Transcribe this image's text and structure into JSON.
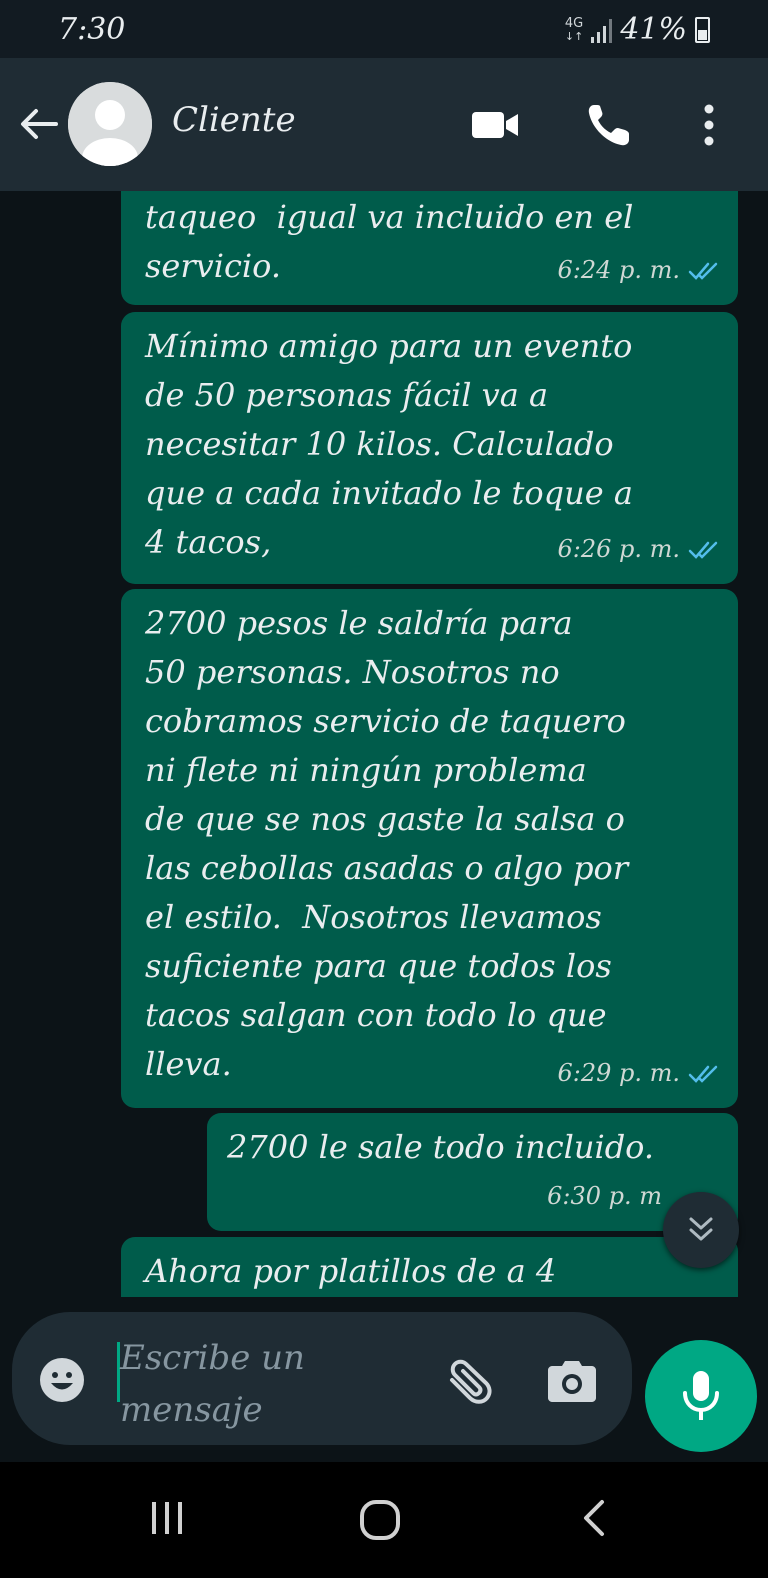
{
  "status": {
    "time": "7:30",
    "network": "4G",
    "battery": "41%"
  },
  "header": {
    "contact_name": "Cliente"
  },
  "messages": [
    {
      "text": "taqueo  igual va incluido en el\nservicio.",
      "time": "6:24 p. m."
    },
    {
      "text": "Mínimo amigo para un evento\nde 50 personas fácil va a\nnecesitar 10 kilos. Calculado\nque a cada invitado le toque a\n4 tacos,",
      "time": "6:26 p. m."
    },
    {
      "text": "2700 pesos le saldría para\n50 personas. Nosotros no\ncobramos servicio de taquero\nni flete ni ningún problema\nde que se nos gaste la salsa o\nlas cebollas asadas o algo por\nel estilo.  Nosotros llevamos\nsuficiente para que todos los\ntacos salgan con todo lo que\nlleva.",
      "time": "6:29 p. m."
    },
    {
      "text": "2700 le sale todo incluido.",
      "time": "6:30 p. m"
    },
    {
      "text": "Ahora por platillos de a 4",
      "time": ""
    }
  ],
  "composer": {
    "placeholder": "Escribe un mensaje"
  },
  "colors": {
    "bubble_out": "#005c4b",
    "accent": "#00a884",
    "header": "#1f2c34",
    "tick_read": "#53bdeb"
  }
}
